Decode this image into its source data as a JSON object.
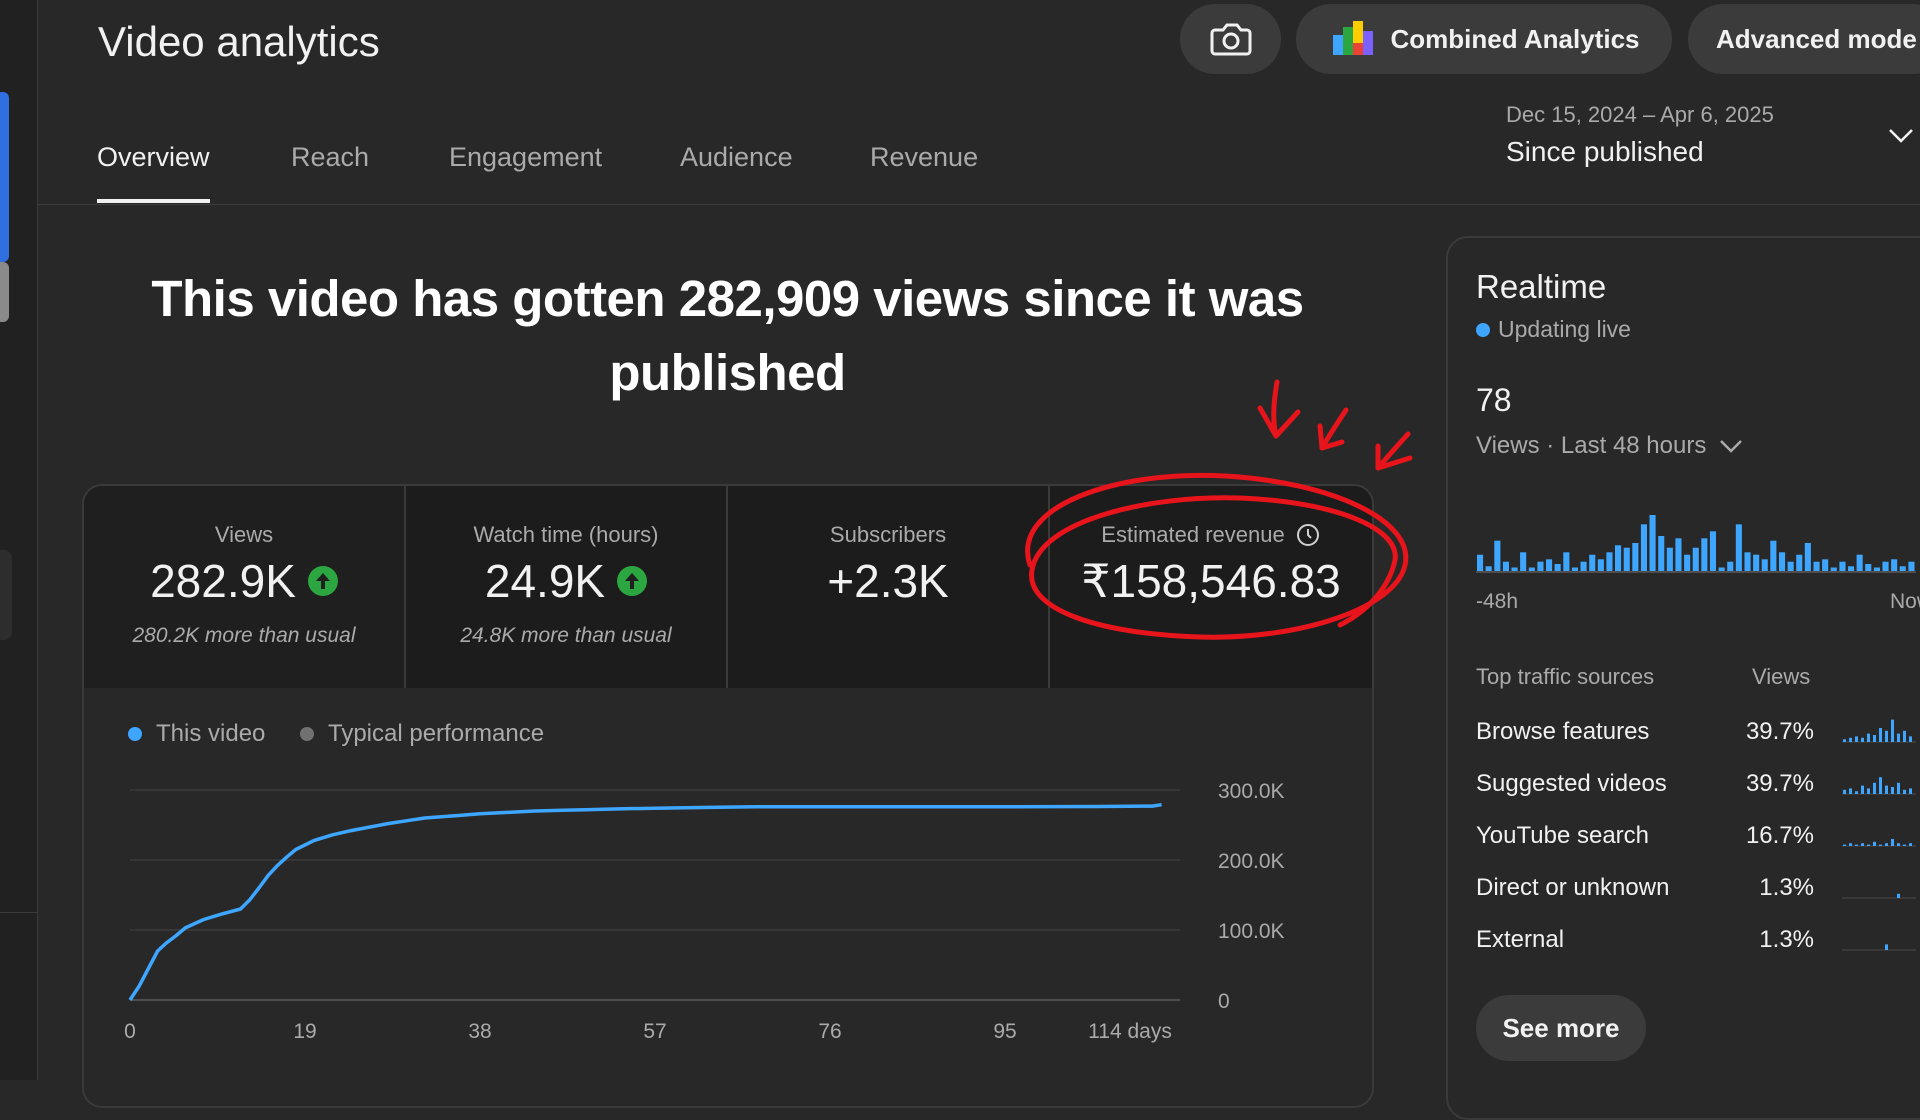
{
  "header": {
    "title": "Video analytics",
    "combined_analytics_label": "Combined Analytics",
    "advanced_mode_label": "Advanced mode"
  },
  "tabs": [
    {
      "label": "Overview",
      "active": true
    },
    {
      "label": "Reach",
      "active": false
    },
    {
      "label": "Engagement",
      "active": false
    },
    {
      "label": "Audience",
      "active": false
    },
    {
      "label": "Revenue",
      "active": false
    }
  ],
  "date_picker": {
    "range": "Dec 15, 2024 – Apr 6, 2025",
    "label": "Since published"
  },
  "headline": "This video has gotten 282,909 views since it was published",
  "metrics": [
    {
      "label": "Views",
      "value": "282.9K",
      "trend": "up",
      "sub": "280.2K more than usual"
    },
    {
      "label": "Watch time (hours)",
      "value": "24.9K",
      "trend": "up",
      "sub": "24.8K more than usual"
    },
    {
      "label": "Subscribers",
      "value": "+2.3K"
    },
    {
      "label": "Estimated revenue",
      "value": "₹158,546.83",
      "icon": "clock-icon"
    }
  ],
  "legend": {
    "this_video": "This video",
    "typical": "Typical performance"
  },
  "colors": {
    "accent": "#3ea6ff",
    "typical": "#717171",
    "up_green": "#2ba640",
    "annotation_red": "#e8141b"
  },
  "chart_data": {
    "type": "line",
    "x_tick_labels": [
      "0",
      "19",
      "38",
      "57",
      "76",
      "95",
      "114 days"
    ],
    "y_tick_labels": [
      "300.0K",
      "200.0K",
      "100.0K",
      "0"
    ],
    "ylim": [
      0,
      300000
    ],
    "xlim": [
      0,
      114
    ],
    "grid": true,
    "series": [
      {
        "name": "This video",
        "x": [
          0,
          1,
          2,
          3,
          4,
          5,
          6,
          8,
          10,
          12,
          13,
          14,
          15,
          16,
          17,
          18,
          20,
          22,
          24,
          26,
          28,
          30,
          32,
          34,
          36,
          38,
          41,
          44,
          47,
          50,
          53,
          57,
          62,
          68,
          76,
          85,
          95,
          105,
          111,
          112
        ],
        "y": [
          0,
          20000,
          45000,
          70000,
          82000,
          92000,
          103000,
          115000,
          123000,
          130000,
          143000,
          160000,
          178000,
          192000,
          204000,
          215000,
          228000,
          236000,
          242000,
          247000,
          252000,
          256000,
          260000,
          262000,
          264000,
          266000,
          268000,
          270000,
          271000,
          272000,
          273000,
          274000,
          275000,
          276000,
          276000,
          276000,
          276000,
          276500,
          277000,
          279000
        ]
      }
    ]
  },
  "realtime": {
    "title": "Realtime",
    "live_label": "Updating live",
    "count": "78",
    "period_label": "Views · Last 48 hours",
    "axis_start": "-48h",
    "axis_end": "Now",
    "bars": [
      14,
      4,
      26,
      8,
      3,
      16,
      3,
      8,
      10,
      6,
      16,
      3,
      8,
      14,
      10,
      16,
      22,
      20,
      24,
      40,
      48,
      30,
      20,
      28,
      14,
      20,
      28,
      34,
      3,
      8,
      40,
      16,
      14,
      10,
      26,
      16,
      8,
      14,
      24,
      8,
      10,
      3,
      8,
      4,
      14,
      6,
      3,
      8,
      10,
      4,
      8
    ]
  },
  "traffic_sources": {
    "header_source": "Top traffic sources",
    "header_views": "Views",
    "rows": [
      {
        "name": "Browse features",
        "pct": "39.7%"
      },
      {
        "name": "Suggested videos",
        "pct": "39.7%"
      },
      {
        "name": "YouTube search",
        "pct": "16.7%"
      },
      {
        "name": "Direct or unknown",
        "pct": "1.3%"
      },
      {
        "name": "External",
        "pct": "1.3%"
      }
    ]
  },
  "see_more_label": "See more"
}
